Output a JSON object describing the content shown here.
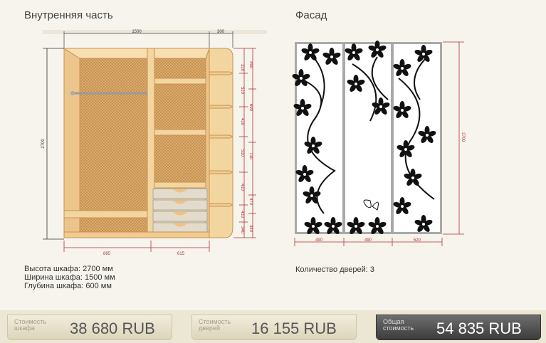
{
  "sections": {
    "inner_title": "Внутренняя часть",
    "facade_title": "Фасад"
  },
  "inner_dims": {
    "top_width": "1500",
    "top_side": "300",
    "left_height": "2700",
    "bottom_left": "885",
    "bottom_right": "615",
    "right_sections": [
      "310",
      "510",
      "410",
      "510",
      "410",
      "410",
      "340"
    ],
    "right_groups": [
      "490",
      "690",
      "730",
      "470",
      "340"
    ]
  },
  "facade_dims": {
    "height": "2700",
    "widths": [
      "490",
      "490",
      "520"
    ]
  },
  "cabinet_info": {
    "height_line": "Высота шкафа: 2700 мм",
    "width_line": "Ширина шкафа: 1500 мм",
    "depth_line": "Глубина шкафа: 600 мм"
  },
  "doors_info": "Количество дверей: 3",
  "prices": {
    "cabinet_label": "Стоимость шкафа",
    "cabinet_value": "38 680  RUB",
    "doors_label": "Стоимость дверей",
    "doors_value": "16 155  RUB",
    "total_label": "Общая стоимость",
    "total_value": "54 835  RUB"
  },
  "colors": {
    "wood": "#f3d5a0",
    "wood_edge": "#c7924f",
    "rattan": "#d9a968",
    "dimension": "#b0303a",
    "frame": "#a9a9a9"
  }
}
